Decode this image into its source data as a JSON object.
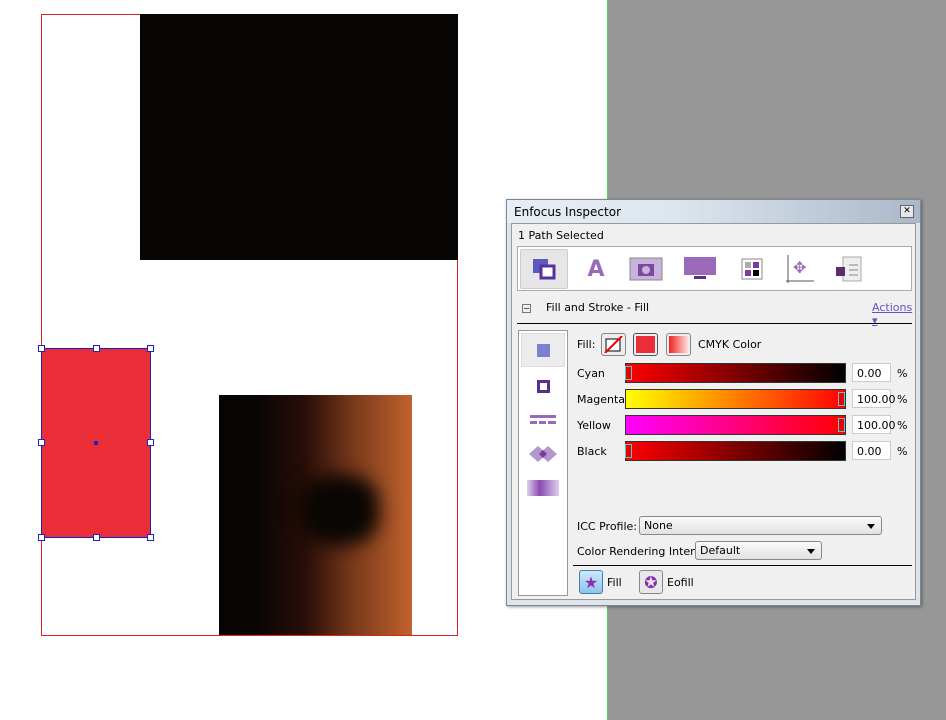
{
  "panel": {
    "title": "Enfocus Inspector",
    "close_icon": "close-icon",
    "selection_status": "1 Path Selected",
    "toolbar": [
      "fill-stroke-icon",
      "text-icon",
      "image-icon",
      "display-icon",
      "color-separations-icon",
      "position-icon",
      "document-info-icon"
    ],
    "section_title": "Fill and Stroke - Fill",
    "actions_label": "Actions",
    "fill_label": "Fill:",
    "color_mode": "CMYK Color",
    "channels": [
      {
        "label": "Cyan",
        "value": "0.00",
        "fraction": 0.0
      },
      {
        "label": "Magenta",
        "value": "100.00",
        "fraction": 1.0
      },
      {
        "label": "Yellow",
        "value": "100.00",
        "fraction": 1.0
      },
      {
        "label": "Black",
        "value": "0.00",
        "fraction": 0.0
      }
    ],
    "percent": "%",
    "icc_label": "ICC Profile:",
    "icc_value": "None",
    "intent_label": "Color Rendering Intent:",
    "intent_value": "Default",
    "fill_button": "Fill",
    "eofill_button": "Eofill"
  },
  "colors": {
    "selected_fill": "#ea2e38",
    "accent": "#6a4fc8"
  }
}
